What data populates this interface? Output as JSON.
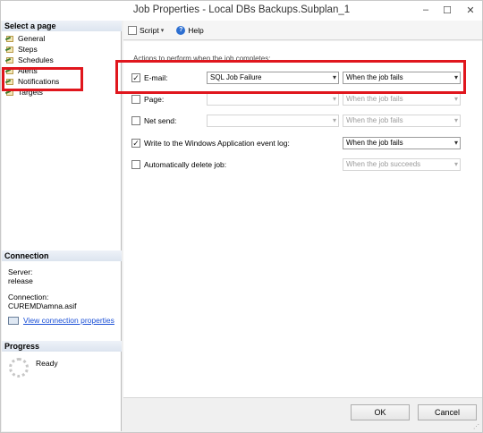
{
  "window": {
    "title": "Job Properties - Local DBs Backups.Subplan_1",
    "controls": {
      "minimize": "–",
      "maximize": "☐",
      "close": "✕"
    }
  },
  "sidebar": {
    "select_page_header": "Select a page",
    "pages": [
      {
        "label": "General",
        "icon": "page-icon"
      },
      {
        "label": "Steps",
        "icon": "page-icon"
      },
      {
        "label": "Schedules",
        "icon": "page-icon"
      },
      {
        "label": "Alerts",
        "icon": "page-icon"
      },
      {
        "label": "Notifications",
        "icon": "page-icon"
      },
      {
        "label": "Targets",
        "icon": "page-icon"
      }
    ],
    "connection_header": "Connection",
    "server_label": "Server:",
    "server_value": "release",
    "connection_label": "Connection:",
    "connection_value": "CUREMD\\amna.asif",
    "view_link": "View connection properties",
    "progress_header": "Progress",
    "progress_status": "Ready"
  },
  "toolbar": {
    "script_label": "Script",
    "help_label": "Help"
  },
  "main": {
    "group_title": "Actions to perform when the job completes:",
    "rows": [
      {
        "label": "E-mail:",
        "checked": true,
        "combo1": "SQL Job Failure",
        "combo1_enabled": true,
        "combo2": "When the job fails",
        "combo2_enabled": true
      },
      {
        "label": "Page:",
        "checked": false,
        "combo1": "",
        "combo1_enabled": false,
        "combo2": "When the job fails",
        "combo2_enabled": false
      },
      {
        "label": "Net send:",
        "checked": false,
        "combo1": "",
        "combo1_enabled": false,
        "combo2": "When the job fails",
        "combo2_enabled": false
      },
      {
        "label": "Write to the Windows Application event log:",
        "checked": true,
        "combo2": "When the job fails",
        "combo2_enabled": true
      },
      {
        "label": "Automatically delete job:",
        "checked": false,
        "combo2": "When the job succeeds",
        "combo2_enabled": false
      }
    ]
  },
  "footer": {
    "ok_label": "OK",
    "cancel_label": "Cancel"
  },
  "colors": {
    "highlight": "#e0161d",
    "link": "#1a4fd6"
  }
}
